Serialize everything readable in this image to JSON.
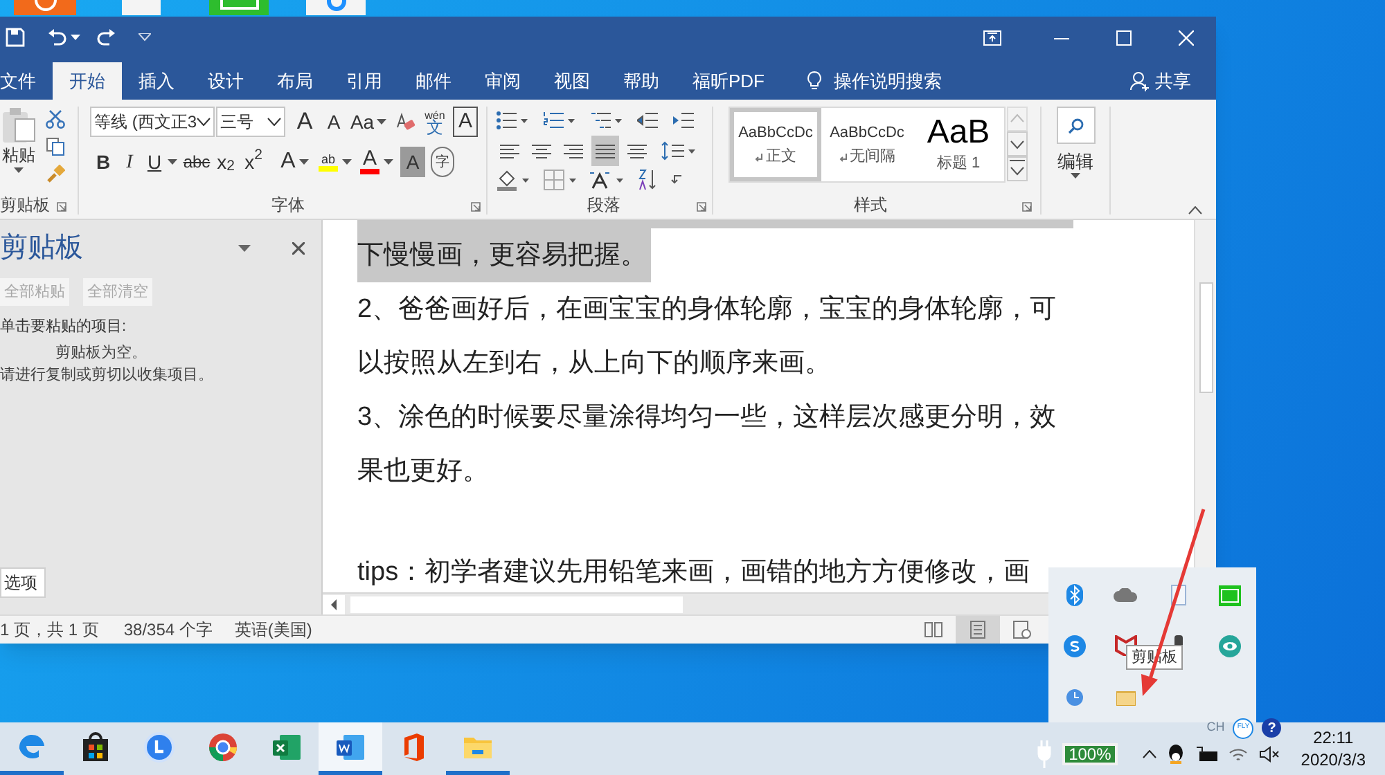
{
  "tabs": [
    {
      "label": "文件",
      "selected": false
    },
    {
      "label": "开始",
      "selected": true
    },
    {
      "label": "插入",
      "selected": false
    },
    {
      "label": "设计",
      "selected": false
    },
    {
      "label": "布局",
      "selected": false
    },
    {
      "label": "引用",
      "selected": false
    },
    {
      "label": "邮件",
      "selected": false
    },
    {
      "label": "审阅",
      "selected": false
    },
    {
      "label": "视图",
      "selected": false
    },
    {
      "label": "帮助",
      "selected": false
    },
    {
      "label": "福昕PDF",
      "selected": false
    }
  ],
  "tell_me": "操作说明搜索",
  "share": "共享",
  "clipboard_group": {
    "paste": "粘贴",
    "label": "剪贴板"
  },
  "font_group": {
    "font_name": "等线 (西文正3",
    "font_size": "三号",
    "label": "字体",
    "row1": [
      {
        "kind": "grow",
        "label": "A"
      },
      {
        "kind": "shrink",
        "label": "A"
      },
      {
        "kind": "case",
        "label": "Aa"
      },
      {
        "kind": "clear"
      },
      {
        "kind": "pinyin",
        "label": "文",
        "ruby": "wén"
      },
      {
        "kind": "border",
        "label": "A"
      }
    ],
    "row2": [
      {
        "kind": "bold",
        "label": "B"
      },
      {
        "kind": "italic",
        "label": "I"
      },
      {
        "kind": "underline",
        "label": "U"
      },
      {
        "kind": "strike",
        "label": "abc"
      },
      {
        "kind": "script",
        "label": "x$_{2}$"
      },
      {
        "kind": "script",
        "label": "x$^{2}$"
      },
      {
        "kind": "effect",
        "label": "A"
      },
      {
        "kind": "highlight",
        "label": "ab"
      },
      {
        "kind": "color",
        "label": "A"
      },
      {
        "kind": "shade",
        "label": "A"
      },
      {
        "kind": "enclose",
        "label": "字"
      }
    ]
  },
  "paragraph_group": {
    "label": "段落",
    "align": [
      {
        "selected": false
      },
      {
        "selected": false
      },
      {
        "selected": false
      },
      {
        "selected": true
      },
      {
        "selected": false
      }
    ]
  },
  "styles_group": {
    "label": "样式",
    "styles": [
      {
        "sample": "AaBbCcDc",
        "name": "正文",
        "para_mark": true,
        "selected": true
      },
      {
        "sample": "AaBbCcDc",
        "name": "无间隔",
        "para_mark": true,
        "selected": false
      },
      {
        "sample": "AaB",
        "name": "标题 1",
        "para_mark": false,
        "selected": false
      }
    ]
  },
  "editing_group": {
    "label": "编辑"
  },
  "clipboard_pane": {
    "title": "剪贴板",
    "buttons": [
      {
        "label": "全部粘贴",
        "disabled": true
      },
      {
        "label": "全部清空",
        "disabled": true
      }
    ],
    "instruction": "单击要粘贴的项目:",
    "empty_lines": [
      "剪贴板为空。",
      "请进行复制或剪切以收集项目。"
    ],
    "options_button": "选项"
  },
  "document": {
    "lines": [
      {
        "text": "下慢慢画，更容易把握。",
        "selected": true
      },
      {
        "text": "2、爸爸画好后，在画宝宝的身体轮廓，宝宝的身体轮廓，可",
        "selected": false
      },
      {
        "text": "以按照从左到右，从上向下的顺序来画。",
        "selected": false
      },
      {
        "text": "3、涂色的时候要尽量涂得均匀一些，这样层次感更分明，效",
        "selected": false
      },
      {
        "text": "果也更好。",
        "selected": false
      },
      {
        "text": "tips：初学者建议先用铅笔来画，画错的地方方便修改，画",
        "selected": false,
        "gap": true
      }
    ]
  },
  "status_bar": {
    "page": "1 页，共 1 页",
    "words": "38/354 个字",
    "language": "英语(美国)",
    "views": [
      {
        "selected": false
      },
      {
        "selected": true
      },
      {
        "selected": false
      }
    ]
  },
  "tray_popup": {
    "tooltip": "剪贴板"
  },
  "taskbar": {
    "apps": [
      {
        "running": true,
        "selected": false
      },
      {
        "running": false,
        "selected": false
      },
      {
        "running": false,
        "selected": false
      },
      {
        "running": false,
        "selected": false
      },
      {
        "running": false,
        "selected": false
      },
      {
        "running": true,
        "selected": true
      },
      {
        "running": false,
        "selected": false
      },
      {
        "running": true,
        "selected": false
      }
    ],
    "ime": "CH",
    "fly_badge": "FLY",
    "help": "?",
    "battery": "100%",
    "time": "22:11",
    "date": "2020/3/3"
  }
}
